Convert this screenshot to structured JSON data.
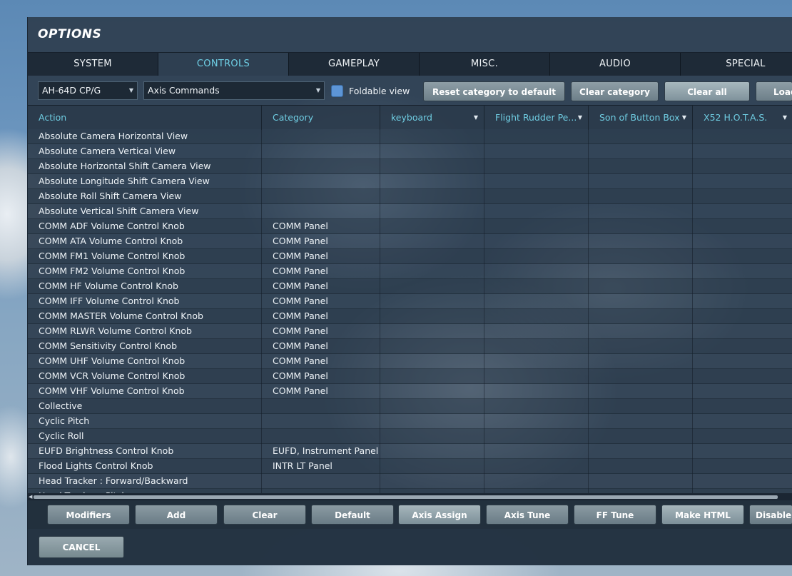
{
  "window": {
    "title": "OPTIONS"
  },
  "tabs": [
    {
      "label": "SYSTEM",
      "active": false
    },
    {
      "label": "CONTROLS",
      "active": true
    },
    {
      "label": "GAMEPLAY",
      "active": false
    },
    {
      "label": "MISC.",
      "active": false
    },
    {
      "label": "AUDIO",
      "active": false
    },
    {
      "label": "SPECIAL",
      "active": false
    }
  ],
  "toolbar": {
    "aircraft_select": "AH-64D CP/G",
    "category_select": "Axis Commands",
    "foldable_view_label": "Foldable view",
    "foldable_view_checked": true,
    "reset_category_label": "Reset category to default",
    "clear_category_label": "Clear category",
    "clear_all_label": "Clear all",
    "load_label": "Load"
  },
  "table": {
    "columns": [
      "Action",
      "Category",
      "keyboard",
      "Flight Rudder Pe...",
      "Son of Button Box",
      "X52 H.O.T.A.S."
    ],
    "rows": [
      [
        "Absolute Camera Horizontal View",
        ""
      ],
      [
        "Absolute Camera Vertical View",
        ""
      ],
      [
        "Absolute Horizontal Shift Camera View",
        ""
      ],
      [
        "Absolute Longitude Shift Camera View",
        ""
      ],
      [
        "Absolute Roll Shift Camera View",
        ""
      ],
      [
        "Absolute Vertical Shift Camera View",
        ""
      ],
      [
        "COMM ADF Volume Control Knob",
        "COMM Panel"
      ],
      [
        "COMM ATA Volume Control Knob",
        "COMM Panel"
      ],
      [
        "COMM FM1 Volume Control Knob",
        "COMM Panel"
      ],
      [
        "COMM FM2 Volume Control Knob",
        "COMM Panel"
      ],
      [
        "COMM HF Volume Control Knob",
        "COMM Panel"
      ],
      [
        "COMM IFF Volume Control Knob",
        "COMM Panel"
      ],
      [
        "COMM MASTER Volume Control Knob",
        "COMM Panel"
      ],
      [
        "COMM RLWR Volume Control Knob",
        "COMM Panel"
      ],
      [
        "COMM Sensitivity Control Knob",
        "COMM Panel"
      ],
      [
        "COMM UHF Volume Control Knob",
        "COMM Panel"
      ],
      [
        "COMM VCR Volume Control Knob",
        "COMM Panel"
      ],
      [
        "COMM VHF Volume Control Knob",
        "COMM Panel"
      ],
      [
        "Collective",
        ""
      ],
      [
        "Cyclic Pitch",
        ""
      ],
      [
        "Cyclic Roll",
        ""
      ],
      [
        "EUFD Brightness Control Knob",
        "EUFD, Instrument Panel"
      ],
      [
        "Flood Lights Control Knob",
        "INTR LT Panel"
      ],
      [
        "Head Tracker : Forward/Backward",
        ""
      ],
      [
        "Head Tracker : Pitch",
        ""
      ]
    ]
  },
  "bottom_buttons": [
    "Modifiers",
    "Add",
    "Clear",
    "Default",
    "Axis Assign",
    "Axis Tune",
    "FF Tune",
    "Make HTML",
    "Disable hot plug"
  ],
  "footer": {
    "cancel_label": "CANCEL"
  },
  "colors": {
    "accent": "#6fd0e6",
    "checkbox": "#5d95d6"
  }
}
